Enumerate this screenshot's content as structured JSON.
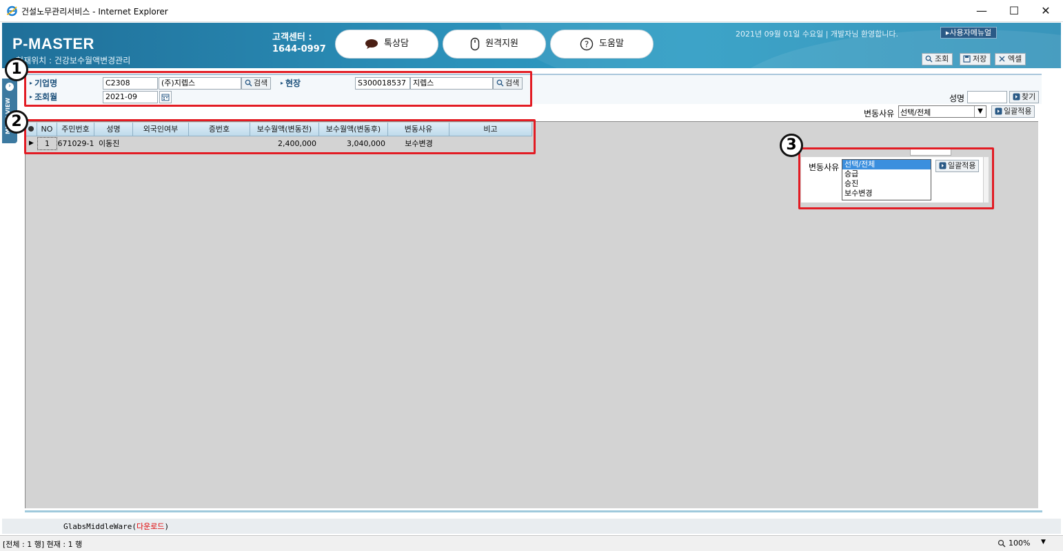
{
  "window": {
    "title": "건설노무관리서비스 - Internet Explorer",
    "minimize": "—",
    "maximize": "☐",
    "close": "✕"
  },
  "header": {
    "logo": "P-MASTER",
    "location": "현재위치 : 건강보수월액변경관리",
    "customer_center_label": "고객센터 :",
    "customer_center_phone": "1644-0997",
    "pills": {
      "consult": "톡상담",
      "remote": "원격지원",
      "help": "도움말"
    },
    "welcome": "2021년 09월 01일 수요일 | 개발자님 환영합니다.",
    "user_manual": "▸사용자메뉴얼",
    "actions": {
      "search": "조회",
      "save": "저장",
      "excel": "엑셀"
    }
  },
  "sidetab": {
    "label": "MENU VIEW"
  },
  "search": {
    "company_label": "기업명",
    "company_code": "C2308",
    "company_name": "(주)지렙스",
    "site_label": "현장",
    "site_code": "S300018537",
    "site_name": "지렙스",
    "search_btn": "검색",
    "month_label": "조회월",
    "month_value": "2021-09",
    "name_label": "성명",
    "name_value": "",
    "find_btn": "찾기"
  },
  "bulk": {
    "reason_label": "변동사유",
    "reason_selected": "선택/전체",
    "apply_btn": "일괄적용"
  },
  "grid": {
    "headers": {
      "no": "NO",
      "rrn": "주민번호",
      "name": "성명",
      "foreign": "외국인여부",
      "cert_no": "증번호",
      "before": "보수월액(변동전)",
      "after": "보수월액(변동후)",
      "reason": "변동사유",
      "note": "비고"
    },
    "rows": [
      {
        "no": "1",
        "rrn": "671029-1",
        "name": "이동진",
        "foreign": "",
        "cert_no": "",
        "before": "2,400,000",
        "after": "3,040,000",
        "reason": "보수변경",
        "note": ""
      }
    ]
  },
  "callout": {
    "reason_label": "변동사유",
    "apply_btn": "일괄적용",
    "options": [
      "선택/전체",
      "승급",
      "승진",
      "보수변경"
    ]
  },
  "annotations": {
    "one": "1",
    "two": "2",
    "three": "3"
  },
  "middleware": {
    "text": "GlabsMiddleWare(",
    "link": "다운로드",
    "close": ")"
  },
  "statusbar": {
    "text": "[전체 : 1 행] 현재 : 1 행",
    "zoom": "100%"
  },
  "colors": {
    "header_blue": "#2b8fb8",
    "annotation_red": "#e21b23",
    "label_blue": "#1a4f7a",
    "selected_option": "#3b8fde"
  }
}
